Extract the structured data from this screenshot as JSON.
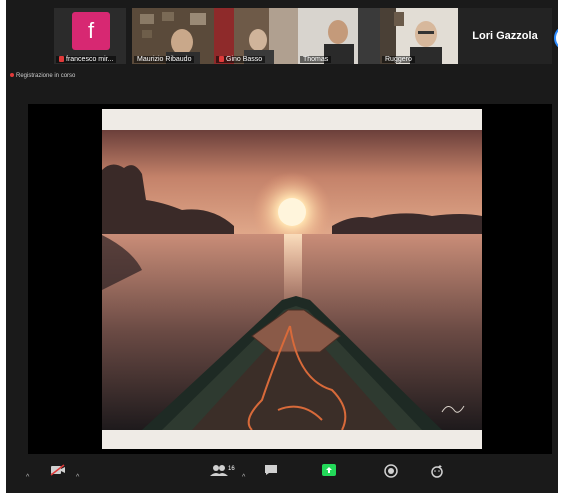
{
  "participants": [
    {
      "name": "francesco mir...",
      "avatar_letter": "f",
      "avatar_color": "#d72872",
      "muted": true
    },
    {
      "name": "Maurizio Ribaudo",
      "muted": false
    },
    {
      "name": "Gino Basso",
      "muted": true
    },
    {
      "name": "Thomas",
      "muted": false
    },
    {
      "name": "Ruggero",
      "muted": false
    },
    {
      "name": "Lori Gazzola",
      "muted": false
    }
  ],
  "recording": {
    "label": "Registrazione in corso"
  },
  "toolbar": {
    "participants_count": "16"
  },
  "colors": {
    "accent": "#2d8cff",
    "share_green": "#23d959",
    "muted_red": "#e03a3a"
  }
}
